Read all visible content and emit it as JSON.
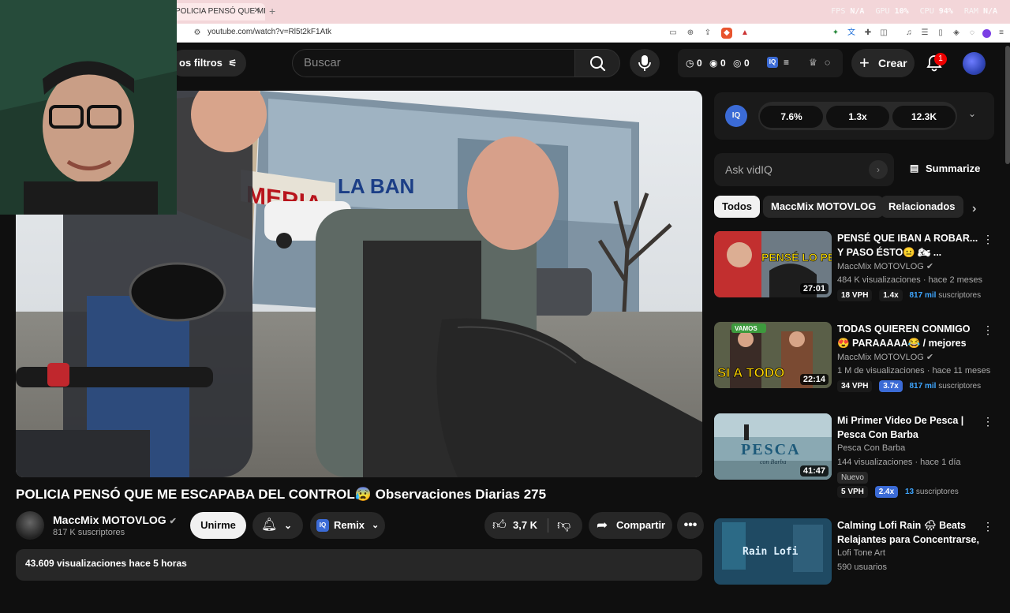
{
  "browser": {
    "tab_title": "POLICIA PENSÓ QUE ME ESCAPABA DEL CONTROL",
    "url": "youtube.com/watch?v=Rl5t2kF1Atk",
    "perf": [
      {
        "label": "FPS",
        "value": "N/A"
      },
      {
        "label": "GPU",
        "value": "10%"
      },
      {
        "label": "CPU",
        "value": "94%"
      },
      {
        "label": "RAM",
        "value": "N/A"
      }
    ]
  },
  "header": {
    "filters_label": "os filtros",
    "search_placeholder": "Buscar",
    "stats": [
      "0",
      "0",
      "0"
    ],
    "create_label": "Crear",
    "notification_count": "1"
  },
  "video": {
    "title": "POLICIA PENSÓ QUE ME ESCAPABA DEL CONTROL😰 Observaciones Diarias 275",
    "channel": "MaccMix MOTOVLOG",
    "subscribers": "817 K suscriptores",
    "join_label": "Unirme",
    "remix_label": "Remix",
    "likes": "3,7 K",
    "share_label": "Compartir",
    "views_line": "43.609 visualizaciones  hace 5 horas",
    "mural_text_1": "MERIA",
    "mural_text_2": "LA BAN"
  },
  "vidiq": {
    "stats": [
      "7.6%",
      "1.3x",
      "12.3K"
    ],
    "ask_placeholder": "Ask vidIQ",
    "summarize_label": "Summarize"
  },
  "chips": [
    "Todos",
    "MaccMix MOTOVLOG",
    "Relacionados"
  ],
  "recommendations": [
    {
      "title": "PENSÉ QUE IBAN A ROBAR... Y PASO ÉSTO😐 🏍 ...",
      "channel": "MaccMix MOTOVLOG",
      "meta": "484 K visualizaciones · hace 2 meses",
      "duration": "27:01",
      "thumb_text": "PENSÉ LO PEOR",
      "vph": "18 VPH",
      "mult": "1.4x",
      "subs_count": "817 mil",
      "subs_label": "suscriptores"
    },
    {
      "title": "TODAS QUIEREN CONMIGO😍 PARAAAAA😂 / mejores clips ...",
      "channel": "MaccMix MOTOVLOG",
      "meta": "1 M de visualizaciones · hace 11 meses",
      "duration": "22:14",
      "thumb_text": "SI A TODO",
      "thumb_badge": "VAMOS",
      "vph": "34 VPH",
      "mult": "3.7x",
      "subs_count": "817 mil",
      "subs_label": "suscriptores"
    },
    {
      "title": "Mi Primer Video De Pesca | Pesca Con Barba",
      "channel": "Pesca Con Barba",
      "meta": "144 visualizaciones · hace 1 día",
      "duration": "41:47",
      "thumb_text": "PESCA",
      "thumb_sub": "con Barba",
      "badge": "Nuevo",
      "vph": "5 VPH",
      "mult": "2.4x",
      "subs_count": "13",
      "subs_label": "suscriptores"
    },
    {
      "title": "Calming Lofi Rain 🌧 Beats Relajantes para Concentrarse, ...",
      "channel": "Lofi Tone Art",
      "meta": "590 usuarios",
      "thumb_text": "Rain Lofi"
    }
  ]
}
